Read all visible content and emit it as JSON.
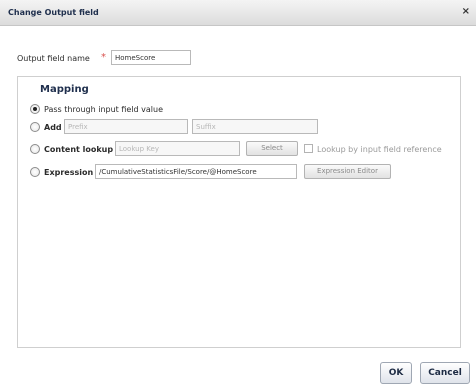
{
  "dialog": {
    "title": "Change Output field",
    "close_symbol": "×"
  },
  "output_field": {
    "label": "Output field name",
    "required_marker": "*",
    "value": "HomeScore"
  },
  "mapping": {
    "title": "Mapping",
    "pass_through": {
      "label": "Pass through input field value",
      "selected": true
    },
    "add": {
      "label": "Add",
      "prefix_placeholder": "Prefix",
      "suffix_placeholder": "Suffix"
    },
    "content_lookup": {
      "label": "Content lookup",
      "key_placeholder": "Lookup Key",
      "select_label": "Select",
      "by_reference_label": "Lookup by input field reference"
    },
    "expression": {
      "label": "Expression",
      "value": "/CumulativeStatisticsFile/Score/@HomeScore",
      "editor_label": "Expression Editor"
    }
  },
  "footer": {
    "ok_label": "OK",
    "cancel_label": "Cancel"
  }
}
